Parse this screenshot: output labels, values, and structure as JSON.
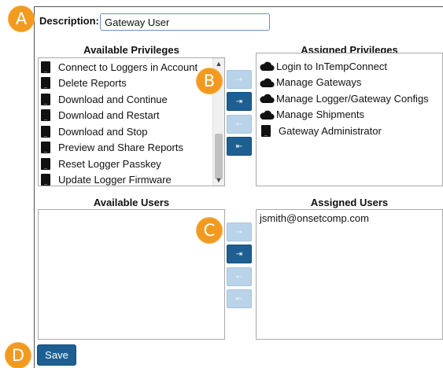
{
  "description": {
    "label": "Description:",
    "value": "Gateway User"
  },
  "available_privileges": {
    "title": "Available Privileges",
    "items": [
      "Connect to Loggers in Account",
      "Delete Reports",
      "Download and Continue",
      "Download and Restart",
      "Download and Stop",
      "Preview and Share Reports",
      "Reset Logger Passkey",
      "Update Logger Firmware"
    ],
    "icon": "device-icon"
  },
  "assigned_privileges": {
    "title": "Assigned Privileges",
    "items": [
      {
        "label": "Login to InTempConnect",
        "icon": "cloud-icon"
      },
      {
        "label": "Manage Gateways",
        "icon": "cloud-icon"
      },
      {
        "label": "Manage Logger/Gateway Configs",
        "icon": "cloud-icon"
      },
      {
        "label": "Manage Shipments",
        "icon": "cloud-icon"
      },
      {
        "label": "Gateway Administrator",
        "icon": "device-icon"
      }
    ]
  },
  "privilege_buttons": {
    "move_right": "→",
    "move_all_right": "⇥",
    "move_left": "←",
    "move_all_left": "⇤"
  },
  "available_users": {
    "title": "Available Users",
    "items": []
  },
  "assigned_users": {
    "title": "Assigned Users",
    "items": [
      "jsmith@onsetcomp.com"
    ]
  },
  "user_buttons": {
    "move_right": "→",
    "move_all_right": "⇥",
    "move_left": "←",
    "move_all_left": "⇤"
  },
  "save_label": "Save",
  "callouts": {
    "a": "A",
    "b": "B",
    "c": "C",
    "d": "D"
  },
  "colors": {
    "accent": "#1d5f93",
    "callout": "#f29a1f",
    "disabled": "#b9d3e8"
  }
}
